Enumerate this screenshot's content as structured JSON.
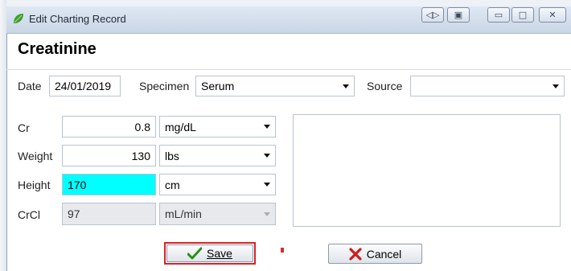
{
  "window": {
    "title": "Edit Charting Record",
    "controls": [
      "restore-nav",
      "dock",
      "minimize",
      "maximize",
      "close"
    ],
    "colors": {
      "titlebar": "#d5dfeb",
      "accent_leaf": "#3f9f2c"
    }
  },
  "form": {
    "heading": "Creatinine",
    "date": {
      "label": "Date",
      "value": "24/01/2019"
    },
    "specimen": {
      "label": "Specimen",
      "value": "Serum"
    },
    "source": {
      "label": "Source",
      "value": ""
    },
    "rows": [
      {
        "label": "Cr",
        "value": "0.8",
        "unit": "mg/dL",
        "highlight": false,
        "disabled": false
      },
      {
        "label": "Weight",
        "value": "130",
        "unit": "lbs",
        "highlight": false,
        "disabled": false
      },
      {
        "label": "Height",
        "value": "170",
        "unit": "cm",
        "highlight": true,
        "disabled": false
      },
      {
        "label": "CrCl",
        "value": "97",
        "unit": "mL/min",
        "highlight": false,
        "disabled": true
      }
    ],
    "notes_value": ""
  },
  "buttons": {
    "save": {
      "label": "Save",
      "icon": "check-icon",
      "color": "#2b8f1c"
    },
    "cancel": {
      "label": "Cancel",
      "icon": "x-icon",
      "color": "#d01b1b"
    }
  },
  "colors": {
    "highlight_field": "#00ffff",
    "focus_outline": "#d8232a"
  }
}
